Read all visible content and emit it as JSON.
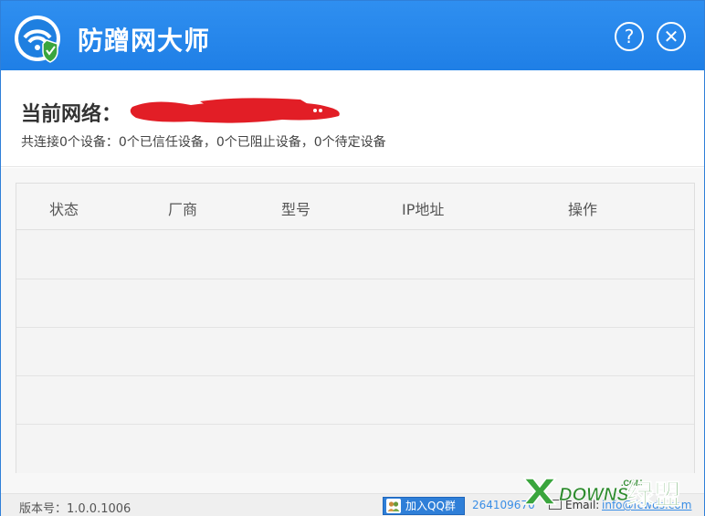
{
  "app": {
    "title": "防蹭网大师"
  },
  "titlebar": {
    "help_symbol": "?",
    "close_symbol": "✕"
  },
  "network": {
    "label": "当前网络：",
    "summary": "共连接0个设备：0个已信任设备，0个已阻止设备，0个待定设备"
  },
  "table": {
    "columns": [
      "状态",
      "厂商",
      "型号",
      "IP地址",
      "操作"
    ],
    "rows": [
      [],
      [],
      [],
      [],
      []
    ]
  },
  "footer": {
    "version": "版本号：1.0.0.1006",
    "qq_group_label": "加入QQ群",
    "qq_group_number": "264109670",
    "email_label": "Email:",
    "email_value": "info@fcwds.com"
  },
  "watermark": {
    "text": "DOWNS绿盟",
    "sub": ".COM"
  },
  "colors": {
    "title_bar": "#1f7fe6",
    "accent": "#2f7fd8",
    "redaction": "#e21e26"
  }
}
